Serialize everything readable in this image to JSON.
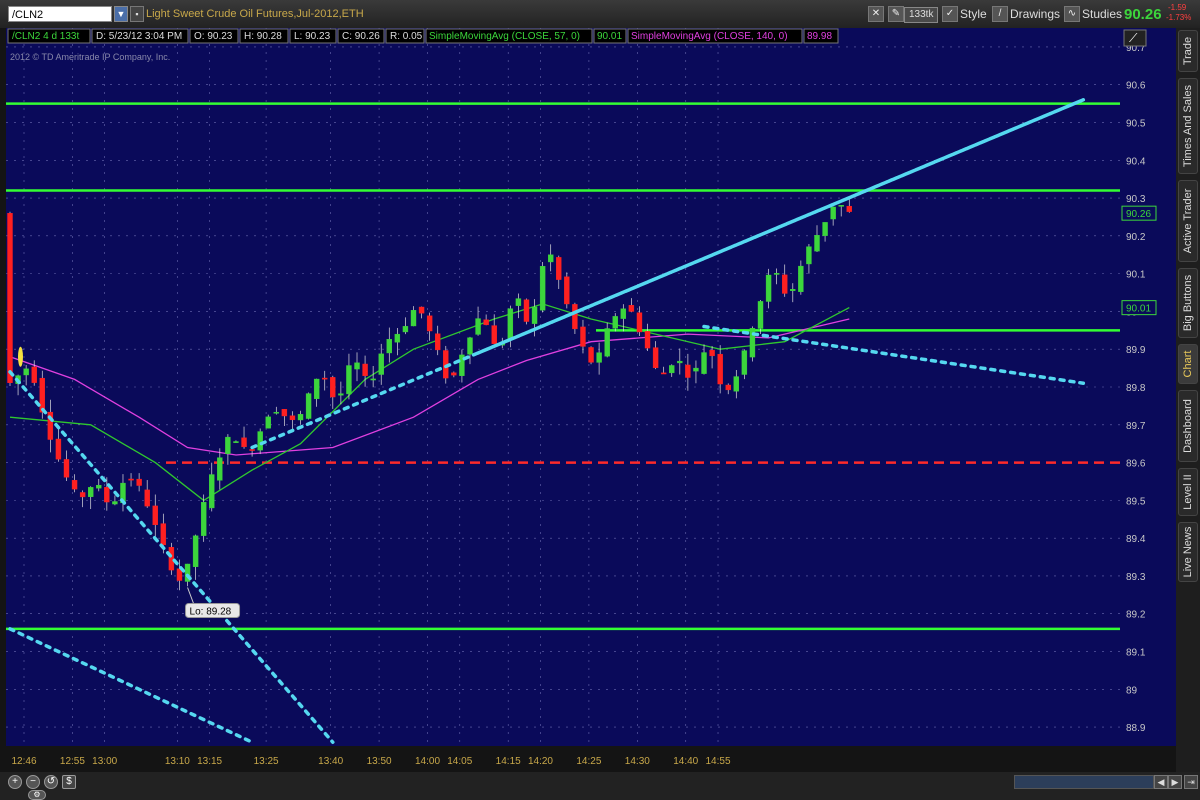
{
  "toolbar": {
    "symbol": "/CLN2",
    "description": "Light Sweet Crude Oil Futures,Jul-2012,ETH",
    "aggregation_badge": "133tk",
    "style_label": "Style",
    "drawings_label": "Drawings",
    "studies_label": "Studies",
    "last_price": "90.26",
    "net_change": "-1.59",
    "pct_change": "-1.73%"
  },
  "header": {
    "symbol_agg": "/CLN2 4 d 133t",
    "date": "D: 5/23/12 3:04 PM",
    "open": "O: 90.23",
    "high": "H: 90.28",
    "low": "L: 90.23",
    "close": "C: 90.26",
    "range": "R: 0.05",
    "sma1_label": "SimpleMovingAvg (CLOSE, 57, 0)",
    "sma1_value": "90.01",
    "sma2_label": "SimpleMovingAvg (CLOSE, 140, 0)",
    "sma2_value": "89.98",
    "copyright": "2012 © TD Ameritrade IP Company, Inc."
  },
  "sidebar": {
    "tabs": [
      "Trade",
      "Times And Sales",
      "Active Trader",
      "Big Buttons",
      "Chart",
      "Dashboard",
      "Level II",
      "Live News"
    ],
    "active": "Chart"
  },
  "colors": {
    "background": "#0a0a5a",
    "up_candle": "#3cd63c",
    "down_candle": "#ff2020",
    "sma57": "#2fc82f",
    "sma140": "#e040e0",
    "level_line": "#33ff33",
    "trendline": "#55d8f0",
    "support_dash": "#ff2a2a",
    "grid": "#6a6ab0"
  },
  "chart_data": {
    "type": "candlestick",
    "ylim": [
      88.85,
      90.75
    ],
    "y_ticks": [
      "90.7",
      "90.6",
      "90.5",
      "90.4",
      "90.3",
      "90.2",
      "90.1",
      "90",
      "89.9",
      "89.8",
      "89.7",
      "89.6",
      "89.5",
      "89.4",
      "89.3",
      "89.2",
      "89.1",
      "89",
      "88.9"
    ],
    "x_ticks": [
      "12:46",
      "12:55",
      "13:00",
      "13:10",
      "13:15",
      "13:25",
      "13:40",
      "13:50",
      "14:00",
      "14:05",
      "14:15",
      "14:20",
      "14:25",
      "14:30",
      "14:40",
      "14:55"
    ],
    "price_path": [
      [
        0,
        89.8
      ],
      [
        3,
        89.86
      ],
      [
        5,
        89.7
      ],
      [
        7,
        89.58
      ],
      [
        9,
        89.5
      ],
      [
        11,
        89.55
      ],
      [
        13,
        89.48
      ],
      [
        15,
        89.57
      ],
      [
        17,
        89.52
      ],
      [
        19,
        89.4
      ],
      [
        21,
        89.3
      ],
      [
        22,
        89.28
      ],
      [
        24,
        89.45
      ],
      [
        26,
        89.6
      ],
      [
        28,
        89.68
      ],
      [
        30,
        89.62
      ],
      [
        33,
        89.75
      ],
      [
        36,
        89.7
      ],
      [
        39,
        89.85
      ],
      [
        41,
        89.75
      ],
      [
        43,
        89.88
      ],
      [
        45,
        89.8
      ],
      [
        47,
        89.92
      ],
      [
        49,
        89.95
      ],
      [
        51,
        90.02
      ],
      [
        53,
        89.92
      ],
      [
        55,
        89.8
      ],
      [
        57,
        89.92
      ],
      [
        59,
        90.0
      ],
      [
        61,
        89.88
      ],
      [
        63,
        90.05
      ],
      [
        65,
        89.95
      ],
      [
        67,
        90.18
      ],
      [
        69,
        90.05
      ],
      [
        71,
        89.92
      ],
      [
        73,
        89.85
      ],
      [
        75,
        89.98
      ],
      [
        77,
        90.02
      ],
      [
        79,
        89.93
      ],
      [
        81,
        89.82
      ],
      [
        83,
        89.88
      ],
      [
        85,
        89.82
      ],
      [
        87,
        89.92
      ],
      [
        89,
        89.78
      ],
      [
        91,
        89.85
      ],
      [
        93,
        90.0
      ],
      [
        95,
        90.12
      ],
      [
        97,
        90.03
      ],
      [
        99,
        90.15
      ],
      [
        101,
        90.22
      ],
      [
        103,
        90.3
      ],
      [
        104,
        90.26
      ]
    ],
    "candle_count": 105,
    "sma57_path": [
      [
        0,
        89.72
      ],
      [
        10,
        89.7
      ],
      [
        18,
        89.6
      ],
      [
        24,
        89.5
      ],
      [
        30,
        89.58
      ],
      [
        36,
        89.65
      ],
      [
        44,
        89.82
      ],
      [
        50,
        89.9
      ],
      [
        60,
        89.98
      ],
      [
        66,
        90.02
      ],
      [
        72,
        89.98
      ],
      [
        80,
        89.94
      ],
      [
        88,
        89.9
      ],
      [
        96,
        89.92
      ],
      [
        104,
        90.01
      ]
    ],
    "sma140_path": [
      [
        0,
        89.88
      ],
      [
        8,
        89.82
      ],
      [
        16,
        89.72
      ],
      [
        22,
        89.64
      ],
      [
        28,
        89.62
      ],
      [
        40,
        89.64
      ],
      [
        50,
        89.72
      ],
      [
        58,
        89.82
      ],
      [
        64,
        89.87
      ],
      [
        72,
        89.92
      ],
      [
        84,
        89.94
      ],
      [
        94,
        89.93
      ],
      [
        104,
        89.98
      ]
    ],
    "horizontal_levels": [
      90.55,
      90.32,
      89.95,
      89.16
    ],
    "support_level": 89.6,
    "trendlines": [
      [
        [
          0,
          89.84
        ],
        [
          40,
          88.86
        ]
      ],
      [
        [
          0,
          89.16
        ],
        [
          30,
          88.86
        ]
      ],
      [
        [
          30,
          89.64
        ],
        [
          133,
          90.56
        ]
      ],
      [
        [
          58,
          89.89
        ],
        [
          133,
          90.56
        ]
      ],
      [
        [
          86,
          89.96
        ],
        [
          133,
          89.81
        ]
      ]
    ],
    "annotations": [
      {
        "text": "Lo: 89.28",
        "x": 22,
        "y": 89.28
      },
      {
        "text": "90.26",
        "x": 104,
        "y": 90.26
      },
      {
        "text": "90.01",
        "x": 104,
        "y": 90.01
      }
    ]
  }
}
